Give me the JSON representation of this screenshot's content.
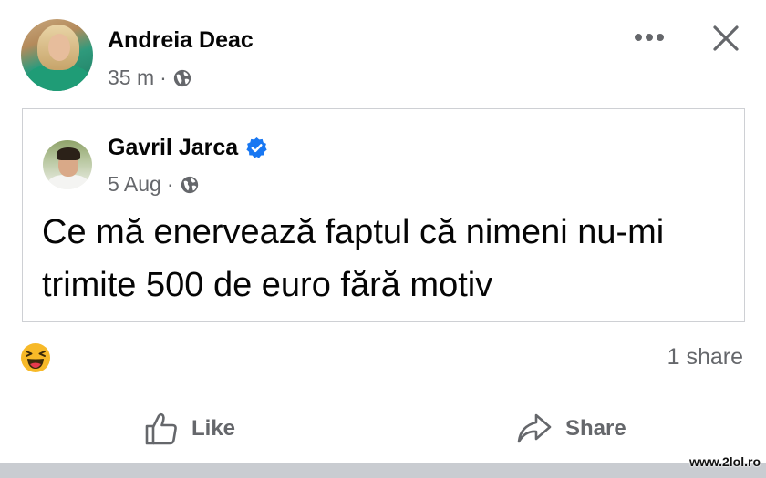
{
  "post": {
    "author": "Andreia Deac",
    "time": "35 m",
    "separator": "·",
    "icons": {
      "privacy": "globe-icon",
      "more": "more-options-icon",
      "close": "close-icon"
    }
  },
  "shared_post": {
    "author": "Gavril Jarca",
    "verified_icon": "verified-badge-icon",
    "date": "5 Aug",
    "separator": "·",
    "text": "Ce mă enervează faptul că nimeni nu-mi trimite 500 de euro fără motiv"
  },
  "reactions": {
    "icon": "haha-reaction-icon",
    "share_count": "1 share"
  },
  "actions": {
    "like_label": "Like",
    "share_label": "Share"
  },
  "watermark": "www.2lol.ro",
  "colors": {
    "text_primary": "#050505",
    "text_secondary": "#65676b",
    "verified_blue": "#1877f2",
    "border": "#ced0d4",
    "haha_yellow": "#f7b928"
  }
}
